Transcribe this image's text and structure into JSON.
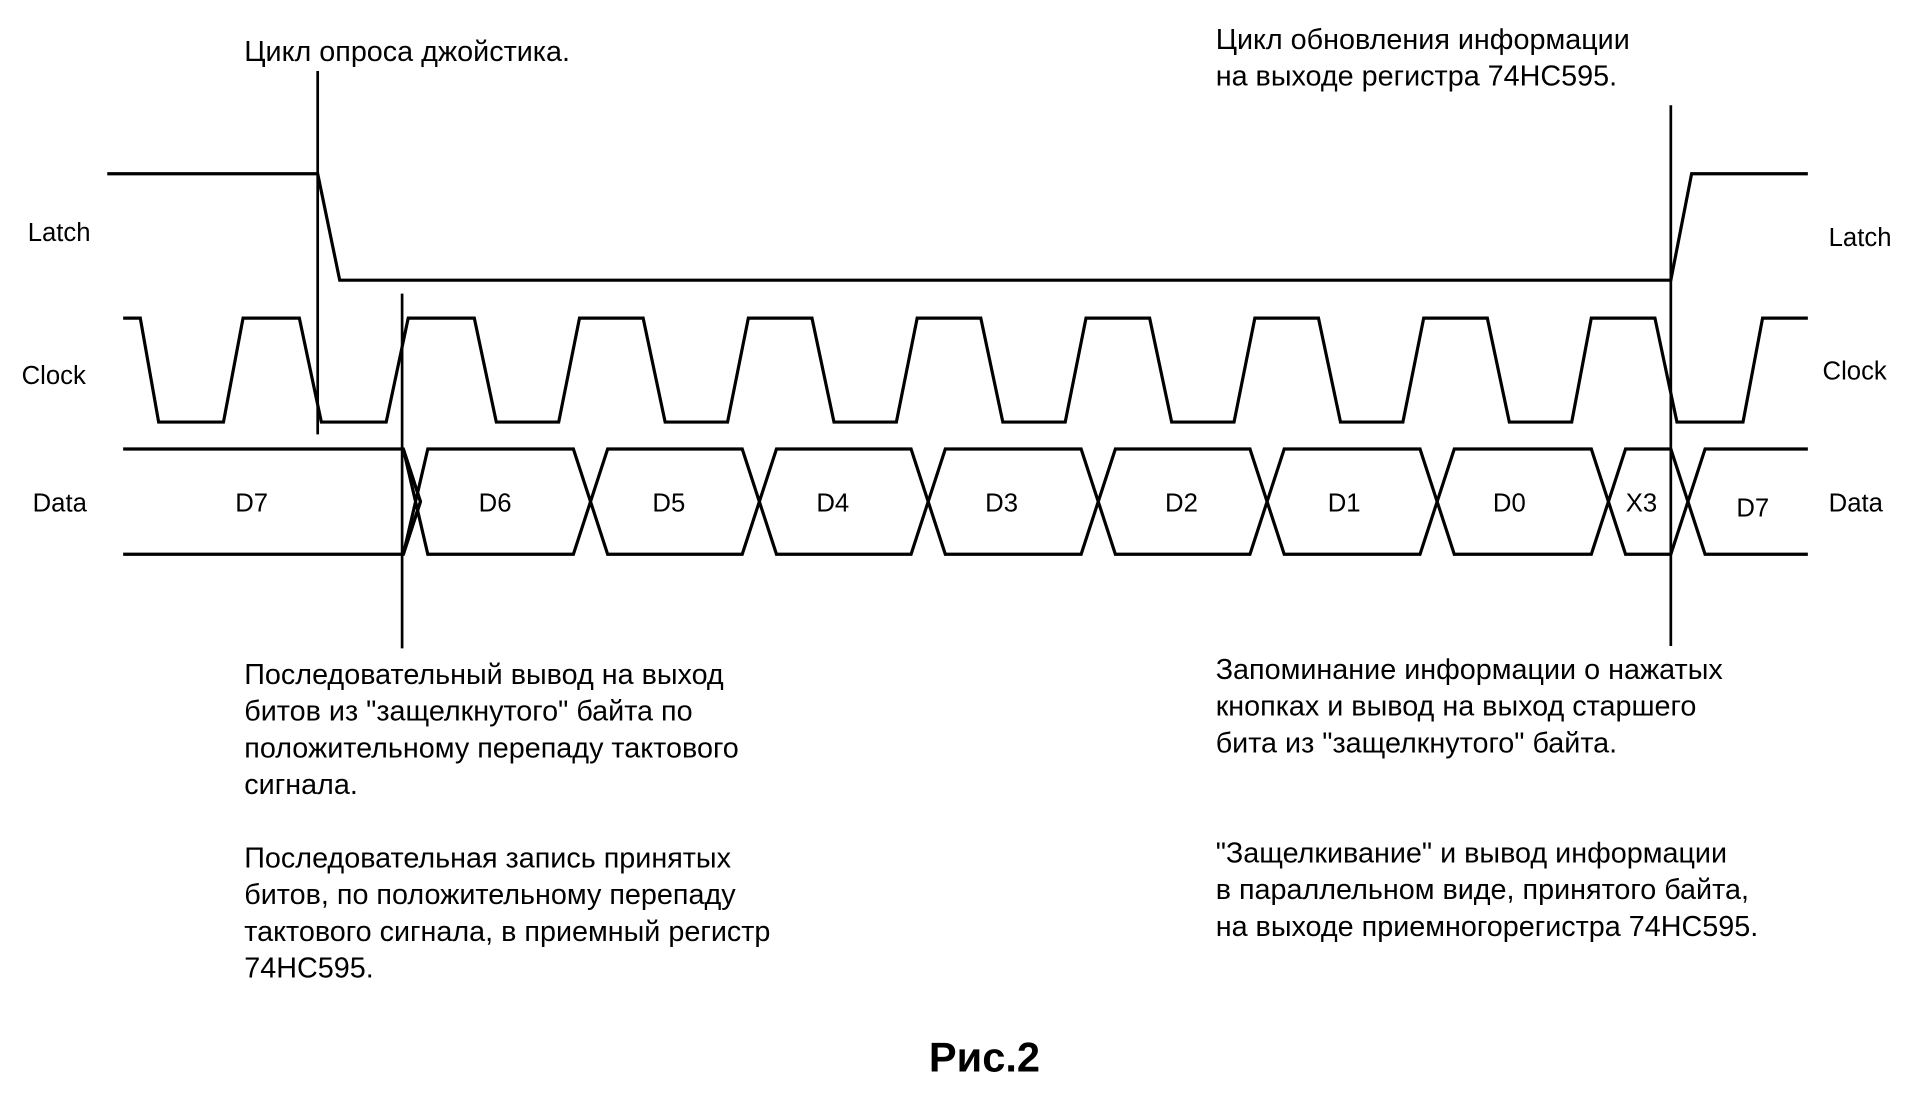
{
  "figure": {
    "caption": "Рис.2",
    "signals": {
      "latch": {
        "left_label": "Latch",
        "right_label": "Latch"
      },
      "clock": {
        "left_label": "Clock",
        "right_label": "Clock"
      },
      "data": {
        "left_label": "Data",
        "right_label": "Data",
        "bits": [
          "D7",
          "D6",
          "D5",
          "D4",
          "D3",
          "D2",
          "D1",
          "D0",
          "X3",
          "D7"
        ]
      }
    },
    "annotations": {
      "poll_cycle": [
        "Цикл опроса джойстика."
      ],
      "update_cycle": [
        "Цикл обновления информации",
        "на выходе регистра 74HC595."
      ],
      "serial_output": [
        "Последовательный вывод на выход",
        "битов из \"защелкнутого\" байта по",
        "положительному перепаду тактового",
        "сигнала."
      ],
      "serial_write": [
        "Последовательная запись принятых",
        "битов, по положительному перепаду",
        "тактового сигнала, в приемный регистр",
        "74HC595."
      ],
      "store_info": [
        "Запоминание информации о нажатых",
        "кнопках и вывод на выход старшего",
        "бита из \"защелкнутого\" байта."
      ],
      "latching": [
        "\"Защелкивание\" и вывод информации",
        "в параллельном виде, принятого байта,",
        "на выходе приемногорегистра 74HC595."
      ]
    }
  }
}
